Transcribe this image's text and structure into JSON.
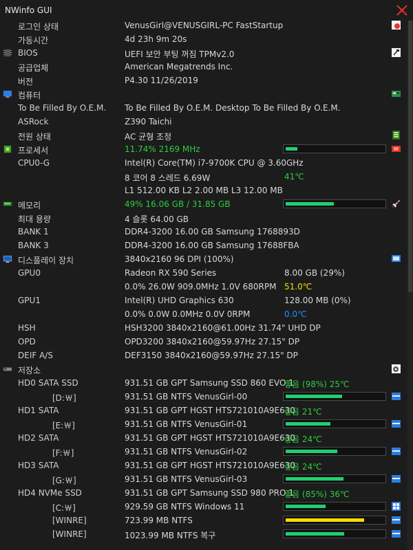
{
  "window": {
    "title": "NWinfo GUI"
  },
  "rows": [
    {
      "label": "로그인 상태",
      "sub": false,
      "value": "VenusGirl@VENUSGIRL-PC FastStartup",
      "icon": "user-icon"
    },
    {
      "label": "가동시간",
      "sub": false,
      "value": "4d 23h 9m 20s"
    },
    {
      "label": "BIOS",
      "sub": false,
      "value": "UEFI 보안 부팅 꺼짐 TPMv2.0",
      "icon": "bios-chip-icon"
    },
    {
      "label": "공급업체",
      "sub": false,
      "value": "American Megatrends Inc."
    },
    {
      "label": "버전",
      "sub": false,
      "value": "P4.30 11/26/2019"
    },
    {
      "label": "컴퓨터",
      "sub": false,
      "value": "",
      "icon": "computer-icon",
      "header": true
    },
    {
      "label": "To Be Filled By O.E.M.",
      "sub": false,
      "value": "To Be Filled By O.E.M. Desktop To Be Filled By O.E.M."
    },
    {
      "label": "ASRock",
      "sub": false,
      "value": "Z390 Taichi"
    },
    {
      "label": "전원 상태",
      "sub": false,
      "value": "AC  균형 조정",
      "icon": "battery-icon"
    },
    {
      "label": "프로세서",
      "sub": false,
      "value": "11.74% 2169 MHz",
      "color": "green",
      "usage": 0.1174,
      "icon": "cpu-icon",
      "header": true
    },
    {
      "label": "CPU0-G",
      "sub": false,
      "value": "Intel(R) Core(TM) i7-9700K CPU @ 3.60GHz"
    },
    {
      "label": "",
      "sub": false,
      "value": "8 코어 8 스레드 6.69W",
      "value2": "41℃",
      "color2": "green"
    },
    {
      "label": "",
      "sub": false,
      "value": "L1 512.00 KB L2 2.00 MB L3 12.00 MB"
    },
    {
      "label": "메모리",
      "sub": false,
      "value": "49% 16.06 GB / 31.85 GB",
      "color": "green",
      "usage": 0.49,
      "icon": "memory-icon",
      "header": true
    },
    {
      "label": "최대 용량",
      "sub": false,
      "value": "4 슬롯  64.00 GB"
    },
    {
      "label": "BANK 1",
      "sub": false,
      "value": "DDR4-3200 16.00 GB Samsung 1768893D"
    },
    {
      "label": "BANK 3",
      "sub": false,
      "value": "DDR4-3200 16.00 GB Samsung 17688FBA"
    },
    {
      "label": "디스플레이 장치",
      "sub": false,
      "value": "3840x2160 96 DPI (100%)",
      "icon": "display-icon",
      "header": true
    },
    {
      "label": "GPU0",
      "sub": false,
      "value": "Radeon RX 590 Series",
      "value2": "8.00 GB (29%)"
    },
    {
      "label": "",
      "sub": false,
      "value": "0.0% 26.0W 909.0MHz 1.0V 680RPM",
      "value2": "51.0℃",
      "color2": "yellow"
    },
    {
      "label": "GPU1",
      "sub": false,
      "value": "Intel(R) UHD Graphics 630",
      "value2": "128.00 MB (0%)"
    },
    {
      "label": "",
      "sub": false,
      "value": "0.0% 0.0W 0.0MHz 0.0V 0RPM",
      "value2": "0.0℃",
      "color2": "blue"
    },
    {
      "label": "HSH",
      "sub": false,
      "value": "HSH3200  3840x2160@61.00Hz  31.74\"  UHD  DP"
    },
    {
      "label": "OPD",
      "sub": false,
      "value": "OPD3200  3840x2160@59.97Hz  27.15\"  DP"
    },
    {
      "label": "DEIF A/S",
      "sub": false,
      "value": "DEF3150  3840x2160@59.97Hz  27.15\"  DP"
    },
    {
      "label": "저장소",
      "sub": false,
      "value": "",
      "icon": "storage-icon",
      "header": true
    },
    {
      "label": "HD0 SATA SSD",
      "sub": false,
      "value": "931.51 GB GPT Samsung SSD 860 EVO 1",
      "value2": "좋음 (98%) 25℃",
      "color2": "green"
    },
    {
      "label": "[D:￦]",
      "sub": true,
      "value": "931.51 GB NTFS VenusGirl-00",
      "usage": 0.58,
      "icon": "drive-icon"
    },
    {
      "label": "HD1 SATA",
      "sub": false,
      "value": "931.51 GB GPT HGST HTS721010A9E630",
      "value2": "좋음  21℃",
      "color2": "green"
    },
    {
      "label": "[E:￦]",
      "sub": true,
      "value": "931.51 GB NTFS VenusGirl-01",
      "usage": 0.46,
      "icon": "drive-icon"
    },
    {
      "label": "HD2 SATA",
      "sub": false,
      "value": "931.51 GB GPT HGST HTS721010A9E630",
      "value2": "좋음  24℃",
      "color2": "green"
    },
    {
      "label": "[F:￦]",
      "sub": true,
      "value": "931.51 GB NTFS VenusGirl-02",
      "usage": 0.53,
      "icon": "drive-icon"
    },
    {
      "label": "HD3 SATA",
      "sub": false,
      "value": "931.51 GB GPT HGST HTS721010A9E630",
      "value2": "좋음  24℃",
      "color2": "green"
    },
    {
      "label": "[G:￦]",
      "sub": true,
      "value": "931.51 GB NTFS VenusGirl-03",
      "usage": 0.59,
      "icon": "drive-icon"
    },
    {
      "label": "HD4 NVMe SSD",
      "sub": false,
      "value": "931.51 GB GPT Samsung SSD 980 PRO 1",
      "value2": "좋음 (85%) 36℃",
      "color2": "green"
    },
    {
      "label": "[C:￦]",
      "sub": true,
      "value": "929.59 GB NTFS Windows 11",
      "usage": 0.41,
      "icon": "windows-icon"
    },
    {
      "label": "[WINRE]",
      "sub": true,
      "value": "723.99 MB NTFS",
      "usage": 0.8,
      "fill": "yellow",
      "icon": "drive-icon"
    },
    {
      "label": "[WINRE]",
      "sub": true,
      "value": "1023.99 MB NTFS 복구",
      "usage": 0.6,
      "icon": "drive-icon"
    }
  ]
}
